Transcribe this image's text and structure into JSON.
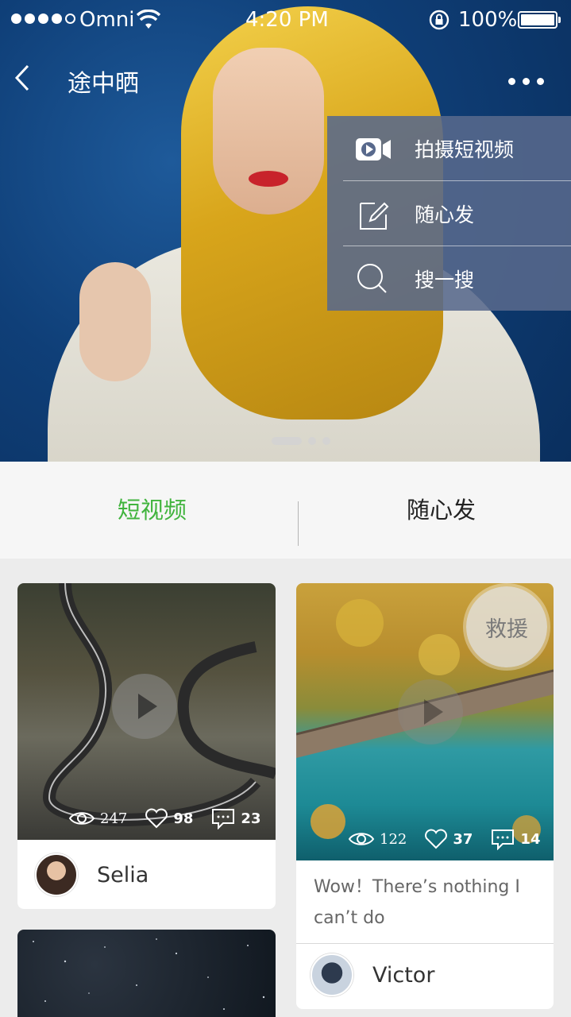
{
  "status_bar": {
    "carrier": "Omni",
    "time": "4:20 PM",
    "battery": "100%"
  },
  "nav": {
    "title": "途中晒"
  },
  "menu": {
    "items": [
      {
        "label": "拍摄短视频",
        "icon": "video-camera-icon"
      },
      {
        "label": "随心发",
        "icon": "edit-icon"
      },
      {
        "label": "搜一搜",
        "icon": "search-icon"
      }
    ]
  },
  "banner": {
    "pager_total": 3,
    "pager_active": 1
  },
  "tabs": {
    "short_video": "短视频",
    "free_post": "随心发",
    "active_color": "#41b43e"
  },
  "feed": {
    "cards": [
      {
        "views": "247",
        "likes": "98",
        "comments": "23",
        "user": "Selia"
      },
      {
        "views": "122",
        "likes": "37",
        "comments": "14",
        "caption": "Wow！There’s nothing I can’t do",
        "user": "Victor"
      }
    ]
  },
  "fab": {
    "label": "救援"
  }
}
